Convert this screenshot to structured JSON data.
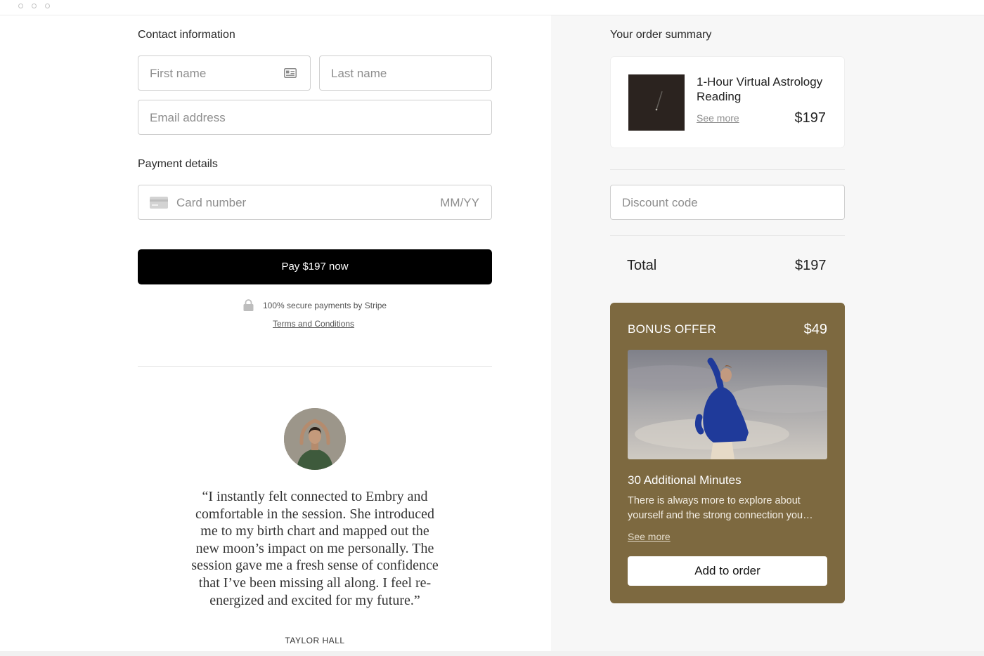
{
  "contact": {
    "title": "Contact information",
    "first_name_placeholder": "First name",
    "last_name_placeholder": "Last name",
    "email_placeholder": "Email address"
  },
  "payment": {
    "title": "Payment details",
    "card_number_placeholder": "Card number",
    "expiry_placeholder": "MM/YY",
    "pay_button": "Pay $197 now",
    "secure_text": "100% secure payments by Stripe",
    "terms_link": "Terms and Conditions"
  },
  "testimonial": {
    "quote": "“I instantly felt connected to Embry and comfortable in the session. She introduced me to my birth chart and mapped out the new moon’s impact on me personally. The session gave me a fresh sense of confidence that I’ve been missing all along. I feel re-energized and excited for my future.”",
    "author": "TAYLOR HALL"
  },
  "summary": {
    "title": "Your order summary",
    "product_name": "1-Hour Virtual Astrology Reading",
    "see_more": "See more",
    "product_price": "$197",
    "discount_placeholder": "Discount code",
    "total_label": "Total",
    "total_value": "$197"
  },
  "bonus": {
    "title": "BONUS OFFER",
    "price": "$49",
    "subtitle": "30 Additional Minutes",
    "description": "There is always more to explore about yourself and the strong connection you…",
    "see_more": "See more",
    "add_button": "Add to order"
  },
  "colors": {
    "bonus_background": "#7d6940",
    "pay_button": "#000000",
    "right_panel": "#f7f7f7"
  },
  "icons": [
    "contact-card-icon",
    "credit-card-icon",
    "lock-icon"
  ]
}
